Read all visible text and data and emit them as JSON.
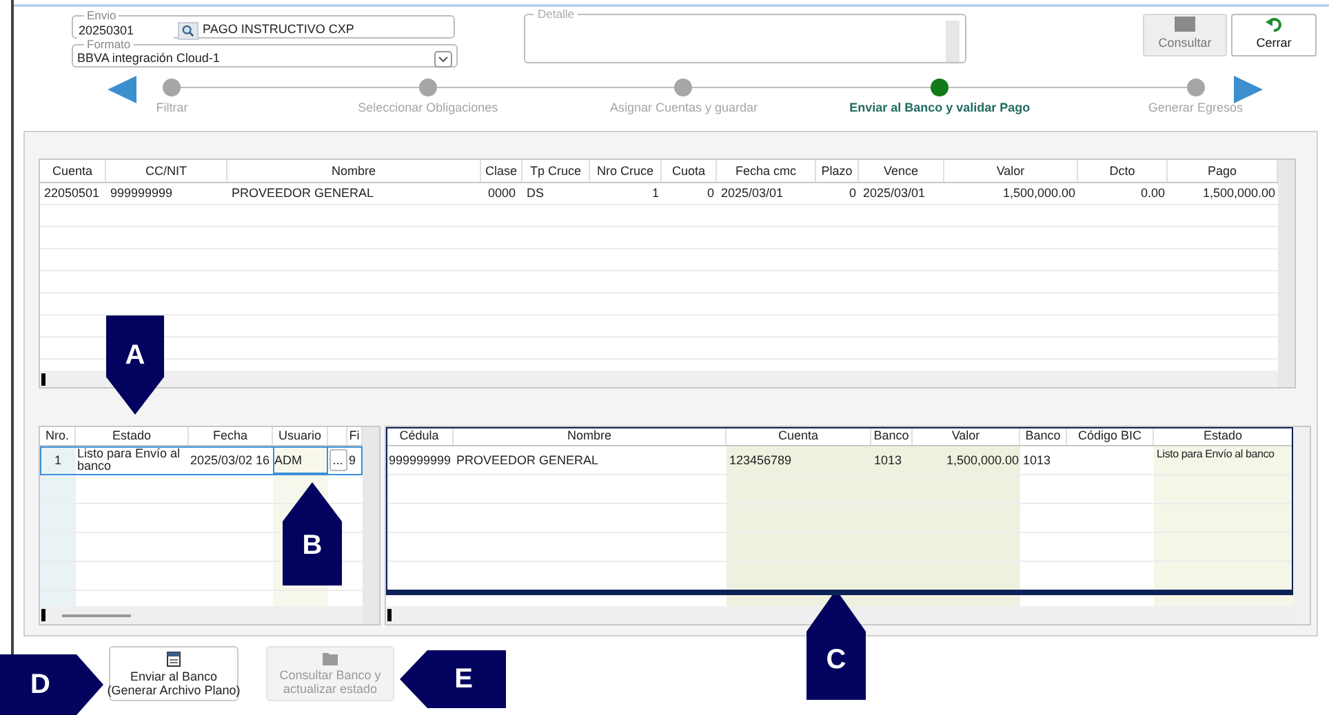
{
  "header": {
    "envio": {
      "label": "Envio",
      "value": "20250301",
      "description": "PAGO INSTRUCTIVO CXP"
    },
    "formato": {
      "label": "Formato",
      "value": "BBVA integración Cloud-1"
    },
    "detalle": {
      "label": "Detalle"
    }
  },
  "toolbar": [
    {
      "label": "Consultar",
      "disabled": true
    },
    {
      "label": "Cerrar",
      "disabled": false
    }
  ],
  "steps": [
    {
      "label": "Filtrar",
      "selected": false
    },
    {
      "label": "Seleccionar Obligaciones",
      "selected": false
    },
    {
      "label": "Asignar Cuentas y guardar",
      "selected": false
    },
    {
      "label": "Enviar al Banco y validar Pago",
      "selected": true
    },
    {
      "label": "Generar Egresos",
      "selected": false
    }
  ],
  "obligations_table": {
    "columns": [
      "Cuenta",
      "CC/NIT",
      "Nombre",
      "Clase",
      "Tp Cruce",
      "Nro Cruce",
      "Cuota",
      "Fecha cmc",
      "Plazo",
      "Vence",
      "Valor",
      "Dcto",
      "Pago"
    ],
    "rows": [
      [
        "22050501",
        "999999999",
        "PROVEEDOR GENERAL",
        "0000",
        "DS",
        "1",
        "0",
        "2025/03/01",
        "0",
        "2025/03/01",
        "1,500,000.00",
        "0.00",
        "1,500,000.00"
      ]
    ]
  },
  "shipments_table": {
    "columns": [
      {
        "kind": "text",
        "label": "Nro."
      },
      {
        "kind": "text",
        "label": "Estado"
      },
      {
        "kind": "text",
        "label": "Fecha"
      },
      {
        "kind": "text",
        "label": "Usuario"
      },
      {
        "kind": "button"
      },
      {
        "kind": "text",
        "label": "Fi"
      }
    ],
    "rows": [
      {
        "selected": true,
        "cells": [
          "1",
          "Listo para Envío al banco",
          "2025/03/02 16",
          "ADM",
          "...",
          "9"
        ]
      }
    ]
  },
  "details_table": {
    "highlighted": true,
    "columns": [
      "Cédula",
      "Nombre",
      "Cuenta",
      "Banco",
      "Valor",
      "Banco",
      "Código BIC",
      "Estado"
    ],
    "rows": [
      [
        "999999999",
        "PROVEEDOR GENERAL",
        "123456789",
        "1013",
        "1,500,000.00",
        "1013",
        "",
        "Listo para Envío al banco"
      ]
    ]
  },
  "actions": [
    {
      "label": "Enviar al Banco\n(Generar Archivo Plano)",
      "disabled": false
    },
    {
      "label": "Consultar Banco y\nactualizar estado",
      "disabled": true
    }
  ],
  "callouts": [
    {
      "label": "A",
      "kind": "down"
    },
    {
      "label": "B",
      "kind": "up"
    },
    {
      "label": "C",
      "kind": "up"
    },
    {
      "label": "D",
      "kind": "right"
    },
    {
      "label": "E",
      "kind": "left"
    }
  ]
}
